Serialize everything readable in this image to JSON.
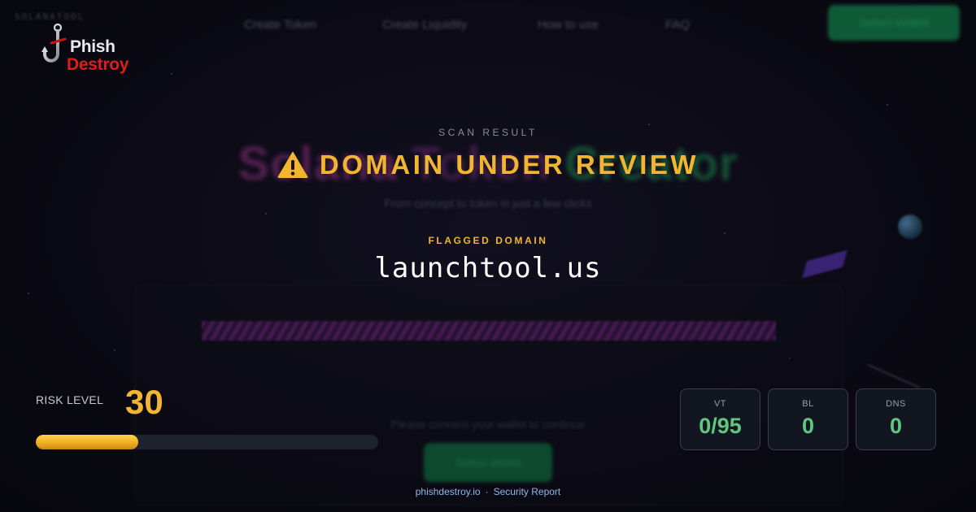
{
  "background_site": {
    "brand": "SOLANATOOL",
    "nav": [
      "Create Token",
      "Create Liquidity",
      "How to use",
      "FAQ"
    ],
    "wallet_button": "Select Wallet",
    "hero_words": [
      "Solana",
      "Token",
      "Creator"
    ],
    "hero_sub": "From concept to token in just a few clicks",
    "connect_prompt": "Please connect your wallet to continue",
    "connect_button": "Select Wallet"
  },
  "logo": {
    "line1": "Phish",
    "line2": "Destroy"
  },
  "result": {
    "scan_label": "SCAN RESULT",
    "headline": "DOMAIN UNDER REVIEW",
    "flag_label": "FLAGGED DOMAIN",
    "domain": "launchtool.us"
  },
  "risk": {
    "label": "RISK LEVEL",
    "score": "30",
    "fill_percent": 30
  },
  "stats": [
    {
      "label": "VT",
      "value": "0/95"
    },
    {
      "label": "BL",
      "value": "0"
    },
    {
      "label": "DNS",
      "value": "0"
    }
  ],
  "footer": {
    "site": "phishdestroy.io",
    "separator": "·",
    "report": "Security Report"
  },
  "colors": {
    "warning": "#f1b52f",
    "safe": "#5fc77f",
    "brand_red": "#e01d1d",
    "footer_link": "#8fb6ea"
  },
  "icons": {
    "warning": "warning-triangle-icon",
    "logo": "fish-hook-icon"
  }
}
